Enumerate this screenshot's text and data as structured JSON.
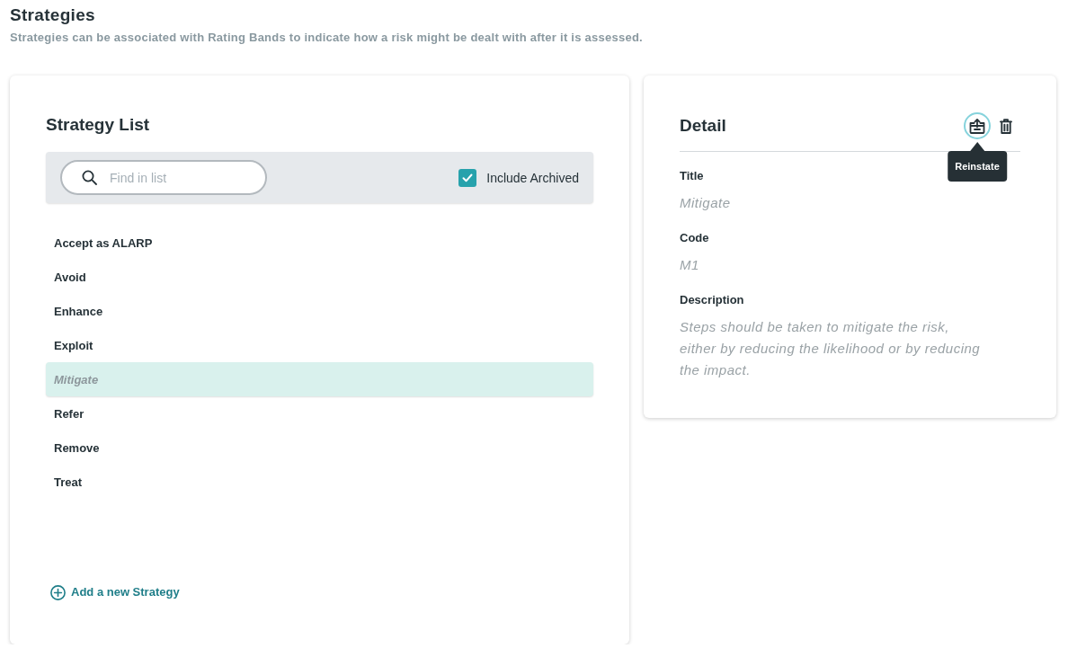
{
  "page": {
    "title": "Strategies",
    "subtitle": "Strategies can be associated with Rating Bands to indicate how a risk might be dealt with after it is assessed."
  },
  "strategy_list": {
    "title": "Strategy List",
    "search": {
      "placeholder": "Find in list"
    },
    "include_archived": {
      "label": "Include Archived",
      "checked": true
    },
    "items": [
      {
        "label": "Accept as ALARP",
        "archived": false,
        "selected": false
      },
      {
        "label": "Avoid",
        "archived": false,
        "selected": false
      },
      {
        "label": "Enhance",
        "archived": false,
        "selected": false
      },
      {
        "label": "Exploit",
        "archived": false,
        "selected": false
      },
      {
        "label": "Mitigate",
        "archived": true,
        "selected": true
      },
      {
        "label": "Refer",
        "archived": false,
        "selected": false
      },
      {
        "label": "Remove",
        "archived": false,
        "selected": false
      },
      {
        "label": "Treat",
        "archived": false,
        "selected": false
      }
    ],
    "add_link": "Add a new Strategy"
  },
  "detail": {
    "title": "Detail",
    "actions": [
      {
        "kind": "reinstate",
        "hovered": true,
        "tooltip": "Reinstate"
      },
      {
        "kind": "delete",
        "hovered": false
      }
    ],
    "fields": [
      {
        "label": "Title",
        "value": "Mitigate"
      },
      {
        "label": "Code",
        "value": "M1"
      },
      {
        "label": "Description",
        "value": "Steps should be taken to mitigate the risk, either by reducing the likelihood or by reducing the impact."
      }
    ]
  }
}
